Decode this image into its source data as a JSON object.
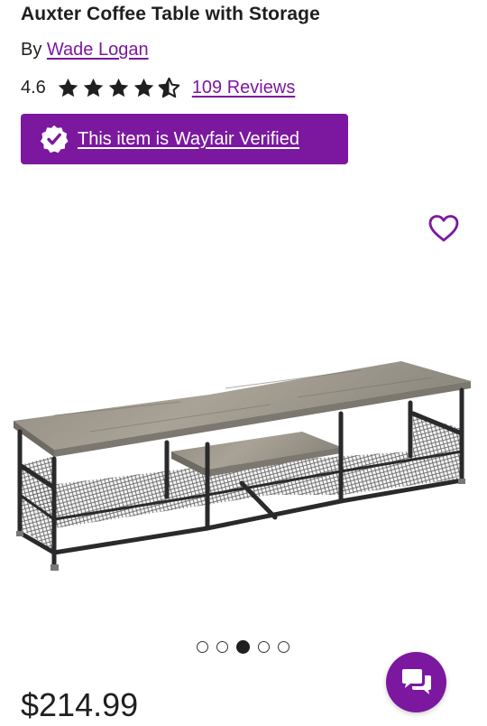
{
  "product": {
    "title": "Auxter Coffee Table with Storage",
    "by_prefix": "By",
    "brand": "Wade Logan",
    "rating": "4.6",
    "stars": 4.6,
    "reviews_label": "109 Reviews",
    "verified_label": "This item is Wayfair Verified",
    "price": "$214.99"
  },
  "gallery": {
    "image_count": 5,
    "active_index": 2,
    "image_subject": "tv-stand-rustic-gray-wood-metal-frame"
  },
  "icons": {
    "favorite": "heart-outline-icon",
    "verified": "verified-check-badge-icon",
    "chat": "chat-bubbles-icon",
    "star": "star-icon"
  },
  "colors": {
    "brand_purple": "#7b189f",
    "text": "#1f1f1f",
    "star": "#1f1f1f"
  }
}
